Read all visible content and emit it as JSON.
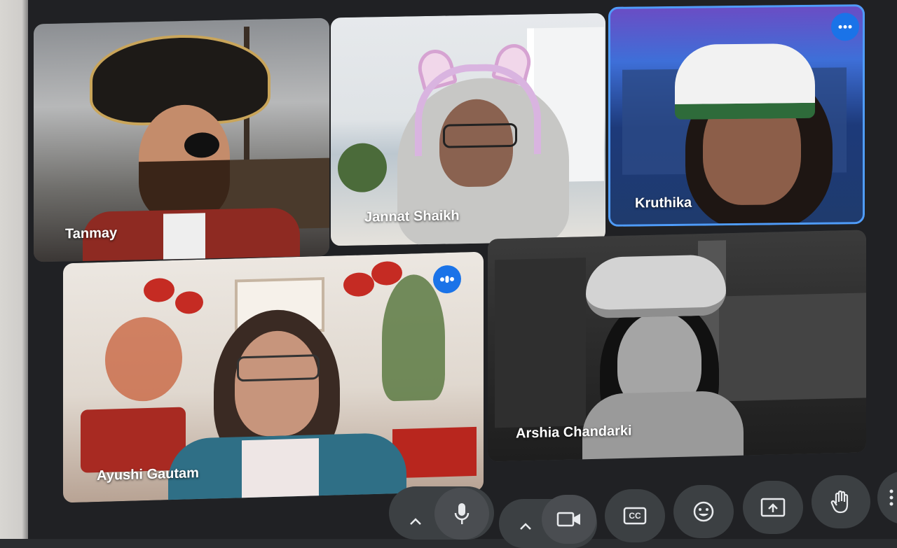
{
  "participants": [
    {
      "name": "Tanmay"
    },
    {
      "name": "Jannat Shaikh"
    },
    {
      "name": "Kruthika"
    },
    {
      "name": "Ayushi Gautam"
    },
    {
      "name": "Arshia Chandarki"
    }
  ],
  "icons": {
    "more_options": "more-options-icon",
    "speaking": "speaking-indicator-icon",
    "mic": "mic-icon",
    "camera": "camera-icon",
    "captions": "captions-icon",
    "emoji": "emoji-icon",
    "present": "present-screen-icon",
    "raise_hand": "raise-hand-icon",
    "chevron_up": "chevron-up-icon"
  },
  "colors": {
    "active_speaker_border": "#4f9cf9",
    "speaking_badge": "#1a73e8",
    "control_bg": "#3c4043",
    "meeting_bg": "#202124"
  },
  "controls": {
    "captions_label": "CC"
  }
}
